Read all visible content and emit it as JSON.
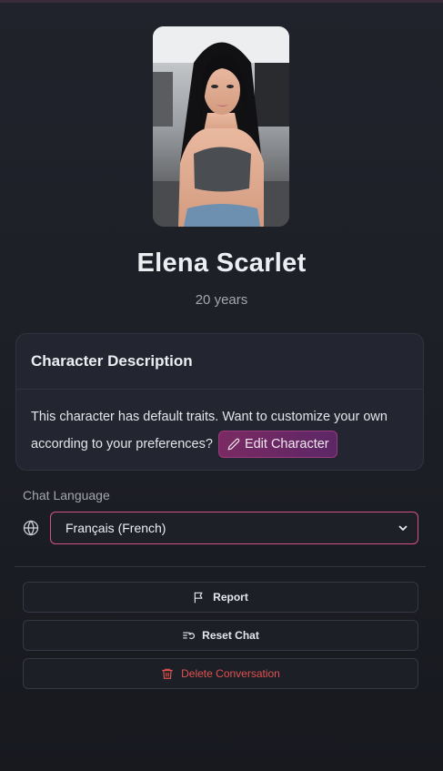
{
  "profile": {
    "name": "Elena Scarlet",
    "age": "20 years"
  },
  "description_card": {
    "title": "Character Description",
    "body_text": "This character has default traits. Want to customize your own according to your preferences?",
    "edit_button_label": "Edit Character"
  },
  "language": {
    "label": "Chat Language",
    "selected": "Français (French)"
  },
  "actions": {
    "report_label": "Report",
    "reset_label": "Reset Chat",
    "delete_label": "Delete Conversation"
  },
  "colors": {
    "accent": "#d6508f",
    "danger": "#e0524f",
    "background": "#1b1d24"
  },
  "icons": {
    "edit": "pencil-icon",
    "language": "globe-icon",
    "select": "chevron-down-icon",
    "report": "flag-icon",
    "reset": "list-reset-icon",
    "delete": "trash-icon"
  }
}
